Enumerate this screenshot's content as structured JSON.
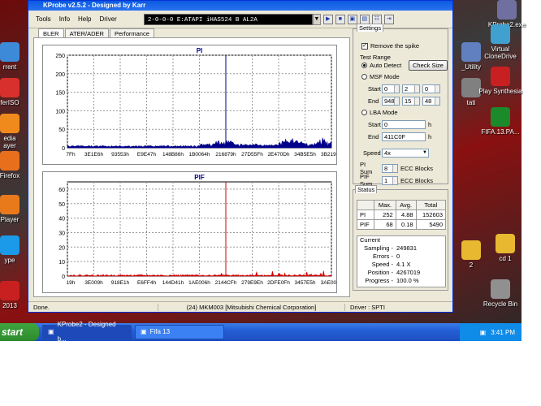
{
  "desktop": {
    "icons_left": [
      {
        "label": "rrent",
        "top": 52,
        "color": "#3c8ad8"
      },
      {
        "label": "ferISO",
        "top": 96,
        "color": "#d8302c"
      },
      {
        "label": "edia\nayer",
        "top": 140,
        "color": "#f08a1c"
      },
      {
        "label": "Firefox",
        "top": 186,
        "color": "#e8701c"
      },
      {
        "label": "Player",
        "top": 240,
        "color": "#e87a1c"
      },
      {
        "label": "ype",
        "top": 290,
        "color": "#1a9ae8"
      },
      {
        "label": "2013",
        "top": 346,
        "color": "#c82020"
      }
    ],
    "icons_right": [
      {
        "label": "KProbe2.exe",
        "left": 596,
        "top": 0,
        "color": "#7070a0"
      },
      {
        "label": "_Utility",
        "left": 552,
        "top": 52,
        "color": "#6080c0"
      },
      {
        "label": "Virtual\nCloneDrive",
        "left": 588,
        "top": 30,
        "color": "#40a0d0"
      },
      {
        "label": "tati",
        "left": 552,
        "top": 96,
        "color": "#808080"
      },
      {
        "label": "Play Synthesia",
        "left": 588,
        "top": 82,
        "color": "#c82020"
      },
      {
        "label": "FIFA.13.PA...",
        "left": 588,
        "top": 132,
        "color": "#1a8a2a"
      },
      {
        "label": "2",
        "left": 552,
        "top": 296,
        "color": "#e8b830"
      },
      {
        "label": "cd 1",
        "left": 594,
        "top": 288,
        "color": "#e8b830"
      },
      {
        "label": "Recycle Bin",
        "left": 588,
        "top": 344,
        "color": "#909090"
      }
    ]
  },
  "taskbar": {
    "start": "start",
    "items": [
      {
        "label": "KProbe2 - Designed b...",
        "active": true
      },
      {
        "label": "Fifa 13",
        "active": false
      }
    ],
    "clock": "3:41 PM"
  },
  "window": {
    "title": "KProbe v2.5.2 - Designed by Karr",
    "menus": [
      "Tools",
      "Info",
      "Help",
      "Driver"
    ],
    "drive": "2-0-0-0 E:ATAPI   iHAS524   B      AL2A",
    "tabs": [
      "BLER",
      "ATER/ADER",
      "Performance"
    ],
    "settings_tab": "Settings",
    "status_tab": "Status",
    "settings": {
      "remove_spike": "Remove the spike",
      "test_range": "Test Range",
      "auto_detect": "Auto Detect",
      "check_size": "Check Size",
      "msf_mode": "MSF Mode",
      "start": "Start",
      "end": "End",
      "msf_start": [
        "0",
        "2",
        "0"
      ],
      "msf_end": [
        "948",
        "15",
        "48"
      ],
      "lba_mode": "LBA Mode",
      "lba_start": "0",
      "lba_end": "411C0F",
      "h": "h",
      "speed_label": "Speed",
      "speed": "4x",
      "pi_sum_label": "PI Sum",
      "pi_sum": "8",
      "pif_sum_label": "PIF Sum",
      "pif_sum": "1",
      "ecc_blocks": "ECC Blocks"
    },
    "status": {
      "headers": [
        "",
        "Max.",
        "Avg.",
        "Total"
      ],
      "rows": [
        [
          "PI",
          "252",
          "4.88",
          "152603"
        ],
        [
          "PIF",
          "68",
          "0.18",
          "5490"
        ]
      ],
      "current_label": "Current",
      "current": [
        [
          "Sampling -",
          "249831"
        ],
        [
          "Errors -",
          "0"
        ],
        [
          "Speed -",
          "4.1  X"
        ],
        [
          "Position -",
          "4267019"
        ],
        [
          "Progress -",
          "100.0 %"
        ]
      ]
    },
    "statusbar": {
      "left": "Done.",
      "mid": "(24) MKM003 [Mitsubishi Chemical Corporation]",
      "right": "Driver : SPTI"
    }
  },
  "chart_data": [
    {
      "type": "area",
      "title": "PI",
      "color": "#00008b",
      "ylim": [
        0,
        250
      ],
      "yticks": [
        0,
        50,
        100,
        150,
        200,
        250
      ],
      "xtick_labels": [
        "7Fh",
        "3E1E6h",
        "93553h",
        "E9E47h",
        "148B86h",
        "1B0064h",
        "216879h",
        "27D55Fh",
        "2E470Dh",
        "34B5E5h",
        "3B2193h"
      ],
      "marker_label": "216879h",
      "marker_value": 250,
      "baseline": 5,
      "bumps": [
        {
          "at": 0.6,
          "value": 20
        },
        {
          "at": 0.85,
          "value": 25
        },
        {
          "at": 0.97,
          "value": 18
        }
      ]
    },
    {
      "type": "area",
      "title": "PIF",
      "color": "#d00000",
      "ylim": [
        0,
        65
      ],
      "yticks": [
        0,
        10,
        20,
        30,
        40,
        50,
        60
      ],
      "xtick_labels": [
        "19h",
        "3E009h",
        "918E1h",
        "E6FF4h",
        "144D41h",
        "1AE006h",
        "2144CFh",
        "279E9Eh",
        "2DFE0Fh",
        "3457E5h",
        "3AE004h"
      ],
      "marker_label": "2144CFh",
      "marker_value": 68,
      "baseline": 1,
      "bumps": []
    }
  ]
}
